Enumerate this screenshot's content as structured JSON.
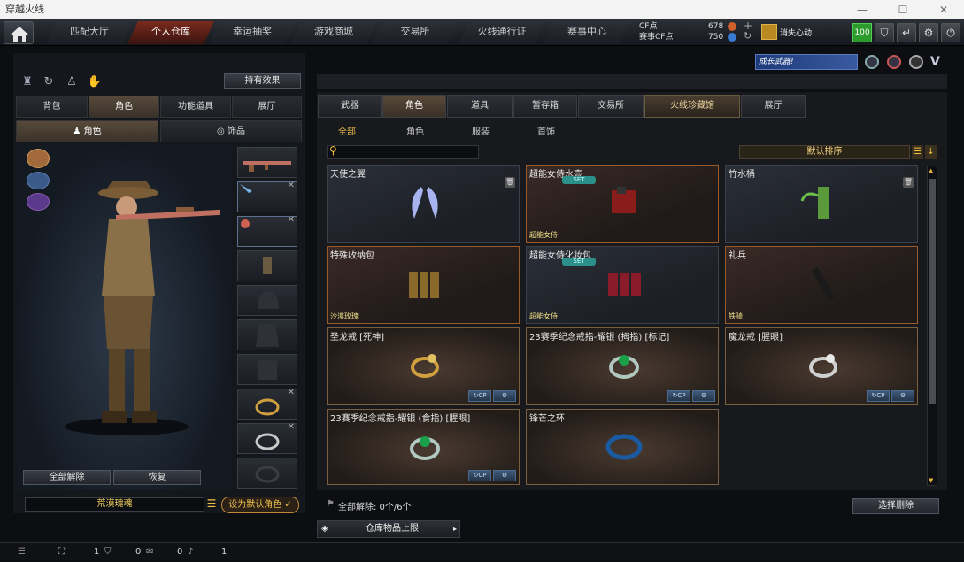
{
  "window": {
    "title": "穿越火线"
  },
  "nav": {
    "tabs": [
      "匹配大厅",
      "个人仓库",
      "幸运抽奖",
      "游戏商城",
      "交易所",
      "火线通行证",
      "赛事中心"
    ],
    "active": 1
  },
  "currency": {
    "cf_label": "CF点",
    "cf_value": "678",
    "match_label": "赛事CF点",
    "match_value": "750"
  },
  "user": {
    "name": "消失心动"
  },
  "level": "100",
  "promo": {
    "label": "成长武器!"
  },
  "left": {
    "effects_button": "持有效果",
    "tabs": [
      "背包",
      "角色",
      "功能道具",
      "展厅"
    ],
    "active_tab": 1,
    "subtabs": [
      "角色",
      "饰品"
    ],
    "unequip_all": "全部解除",
    "restore": "恢复",
    "char_name": "荒漠瑰魂",
    "set_default": "设为默认角色"
  },
  "right": {
    "tabs": [
      "武器",
      "角色",
      "道具",
      "暂存箱",
      "交易所",
      "火线珍藏馆",
      "展厅"
    ],
    "active_tab": 1,
    "filters": [
      "全部",
      "角色",
      "服装",
      "首饰"
    ],
    "search_placeholder": "",
    "sort": "默认排序",
    "items": [
      {
        "name": "天使之翼",
        "tag": "",
        "set": "",
        "style": "plain",
        "trash": true,
        "icon": "wings-icon"
      },
      {
        "name": "超能女侍水壶",
        "tag": "超能女侍",
        "set": "SET",
        "style": "rare",
        "trash": false,
        "icon": "flask-icon"
      },
      {
        "name": "竹水桶",
        "tag": "",
        "set": "",
        "style": "plain",
        "trash": true,
        "icon": "bamboo-icon"
      },
      {
        "name": "特殊收纳包",
        "tag": "沙漠玫瑰",
        "set": "",
        "style": "rare",
        "trash": false,
        "icon": "pouch-icon"
      },
      {
        "name": "超能女侍化妆包",
        "tag": "超能女侍",
        "set": "SET",
        "style": "plain",
        "trash": false,
        "icon": "makeup-bag-icon"
      },
      {
        "name": "礼兵",
        "tag": "铁骑",
        "set": "",
        "style": "rare",
        "trash": false,
        "icon": "baton-icon"
      },
      {
        "name": "圣龙戒 [死神]",
        "tag": "",
        "set": "",
        "style": "gold",
        "trash": false,
        "icon": "dragon-ring-icon",
        "btns": true
      },
      {
        "name": "23赛季纪念戒指-耀银 (拇指) [标记]",
        "tag": "",
        "set": "",
        "style": "gold",
        "trash": false,
        "icon": "emerald-ring-icon",
        "btns": true
      },
      {
        "name": "魔龙戒 [腥眼]",
        "tag": "",
        "set": "",
        "style": "gold",
        "trash": false,
        "icon": "silver-dragon-ring-icon",
        "btns": true
      },
      {
        "name": "23赛季纪念戒指-耀银 (食指) [腥眼]",
        "tag": "",
        "set": "",
        "style": "gold",
        "trash": false,
        "icon": "emerald-ring-icon",
        "btns": true
      },
      {
        "name": "锋芒之环",
        "tag": "",
        "set": "",
        "style": "gold",
        "trash": false,
        "icon": "blue-ring-icon"
      }
    ],
    "unequip_count": "全部解除: 0个/6个",
    "select_delete": "选择删除",
    "capacity": "仓库物品上限"
  },
  "bottom": {
    "counts": [
      "1",
      "0",
      "0",
      "1"
    ]
  }
}
